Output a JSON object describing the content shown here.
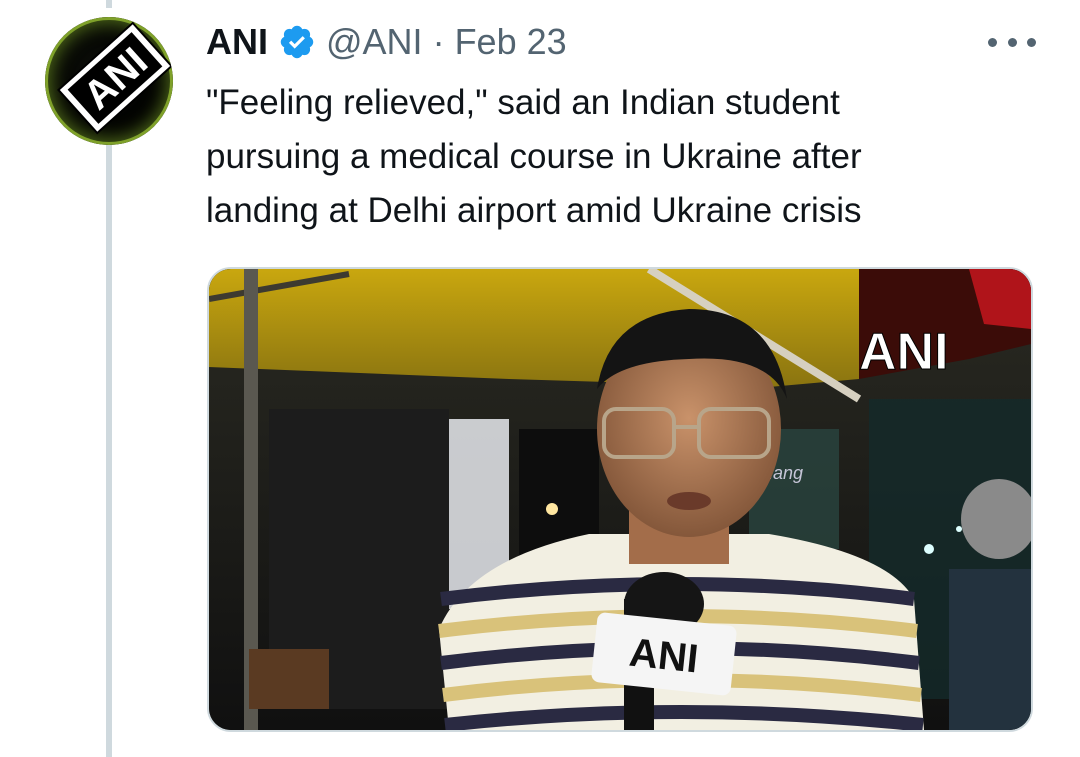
{
  "tweet": {
    "author": {
      "name": "ANI",
      "handle": "@ANI",
      "verified": true,
      "avatar_text": "ANI"
    },
    "separator": "·",
    "date": "Feb 23",
    "text": "\"Feeling relieved,\" said an Indian student\npursuing a medical course in Ukraine after\nlanding at Delhi airport amid Ukraine crisis",
    "media": {
      "type": "video-frame",
      "watermark": "ANI",
      "mic_label": "ANI",
      "background_sign": "iang"
    }
  },
  "colors": {
    "text_primary": "#0f1419",
    "text_secondary": "#536471",
    "verified_blue": "#1d9bf0",
    "thread_line": "#cfd9de"
  },
  "icons": {
    "verified": "verified-badge-icon",
    "more": "more-horizontal-icon"
  }
}
